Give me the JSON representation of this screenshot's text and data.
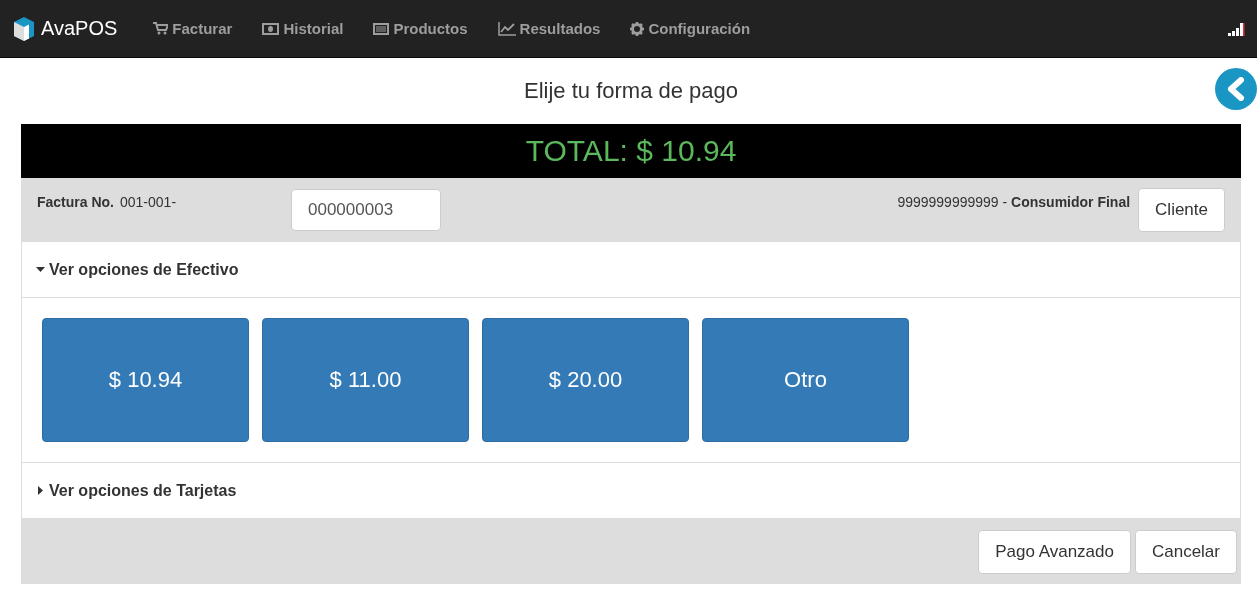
{
  "navbar": {
    "brand": "AvaPOS",
    "items": [
      {
        "label": "Facturar"
      },
      {
        "label": "Historial"
      },
      {
        "label": "Productos"
      },
      {
        "label": "Resultados"
      },
      {
        "label": "Configuración"
      }
    ]
  },
  "title": "Elije tu forma de pago",
  "total": "TOTAL: $ 10.94",
  "invoice": {
    "label": "Factura No.",
    "prefix": "001-001-",
    "number": "000000003"
  },
  "customer": {
    "text": "9999999999999 - **Consumidor Final**",
    "button": "Cliente"
  },
  "sections": [
    {
      "label": "Ver opciones de Efectivo",
      "expanded": true,
      "options": [
        "$ 10.94",
        "$ 11.00",
        "$ 20.00",
        "Otro"
      ]
    },
    {
      "label": "Ver opciones de Tarjetas",
      "expanded": false
    }
  ],
  "footer_buttons": [
    "Pago Avanzado",
    "Cancelar"
  ]
}
